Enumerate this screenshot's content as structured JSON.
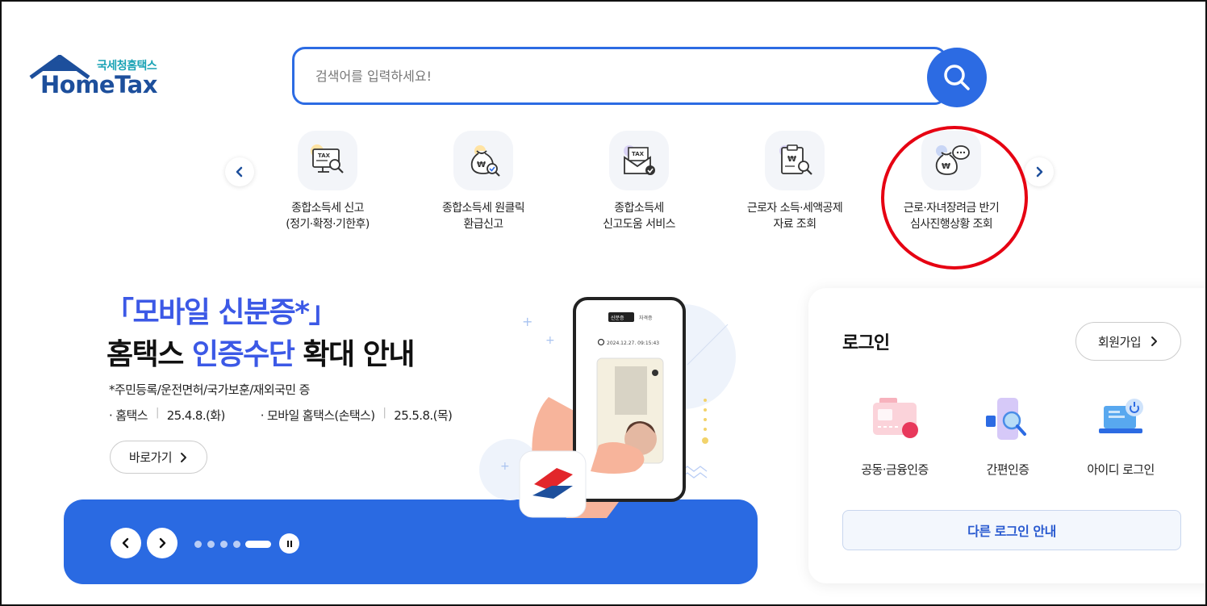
{
  "logo": {
    "sub": "국세청홈택스",
    "main": "HomeTax"
  },
  "search": {
    "placeholder": "검색어를 입력하세요!"
  },
  "quick_menu": [
    {
      "line1": "종합소득세 신고",
      "line2": "(정기·확정·기한후)",
      "icon": "tax-monitor-icon"
    },
    {
      "line1": "종합소득세 원클릭",
      "line2": "환급신고",
      "icon": "money-bag-check-icon"
    },
    {
      "line1": "종합소득세",
      "line2": "신고도움 서비스",
      "icon": "tax-envelope-icon"
    },
    {
      "line1": "근로자 소득·세액공제",
      "line2": "자료 조회",
      "icon": "clipboard-search-icon"
    },
    {
      "line1": "근로·자녀장려금 반기",
      "line2": "심사진행상황 조회",
      "icon": "money-bag-chat-icon"
    }
  ],
  "banner": {
    "title1": "「모바일 신분증*」",
    "title2_a": "홈택스 ",
    "title2_hl": "인증수단",
    "title2_b": " 확대 안내",
    "note": "*주민등록/운전면허/국가보훈/재외국민 증",
    "date1_label": "· 홈택스",
    "date1_value": "25.4.8.(화)",
    "date2_label": "· 모바일 홈택스(손택스)",
    "date2_value": "25.5.8.(목)",
    "go_label": "바로가기",
    "phone_tab1": "신분증",
    "phone_tab2": "자격증",
    "phone_time": "2024.12.27. 09:15:43"
  },
  "carousel": {
    "total": 5,
    "active": 5
  },
  "login": {
    "title": "로그인",
    "join_label": "회원가입",
    "options": [
      {
        "label": "공동·금융인증",
        "icon": "certificate-card-icon"
      },
      {
        "label": "간편인증",
        "icon": "phone-search-icon"
      },
      {
        "label": "아이디 로그인",
        "icon": "laptop-power-icon"
      }
    ],
    "other_label": "다른 로그인 안내"
  },
  "colors": {
    "primary": "#2c6be3",
    "banner_blue": "#3c59e6",
    "highlight_red": "#e60012"
  }
}
